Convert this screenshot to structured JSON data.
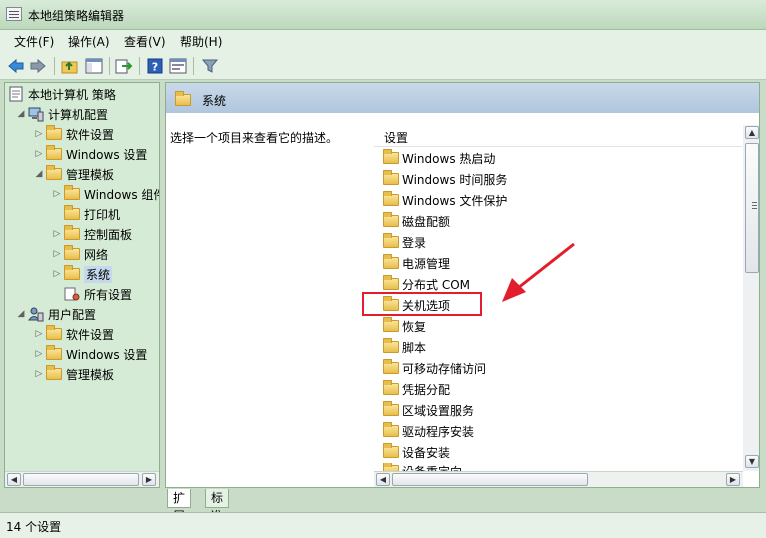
{
  "window": {
    "title": "本地组策略编辑器"
  },
  "menu": [
    "文件(F)",
    "操作(A)",
    "查看(V)",
    "帮助(H)"
  ],
  "toolbar_icons": [
    "back-icon",
    "forward-icon",
    "up-folder-icon",
    "show-hide-tree-icon",
    "export-list-icon",
    "help-icon",
    "properties-icon",
    "filter-icon"
  ],
  "tree": {
    "root": "本地计算机 策略",
    "computer_config": "计算机配置",
    "software_settings_1": "软件设置",
    "windows_settings_1": "Windows 设置",
    "admin_templates_1": "管理模板",
    "windows_components": "Windows 组件",
    "printers": "打印机",
    "control_panel": "控制面板",
    "network": "网络",
    "system": "系统",
    "all_settings": "所有设置",
    "user_config": "用户配置",
    "software_settings_2": "软件设置",
    "windows_settings_2": "Windows 设置",
    "admin_templates_2": "管理模板"
  },
  "right_pane": {
    "header_title": "系统",
    "description": "选择一个项目来查看它的描述。",
    "column_header": "设置",
    "items": [
      "Windows 热启动",
      "Windows 时间服务",
      "Windows 文件保护",
      "磁盘配额",
      "登录",
      "电源管理",
      "分布式 COM",
      "关机选项",
      "恢复",
      "脚本",
      "可移动存储访问",
      "凭据分配",
      "区域设置服务",
      "驱动程序安装",
      "设备安装",
      "设备重定向"
    ]
  },
  "tabs": [
    "扩展",
    "标准"
  ],
  "status": "14 个设置",
  "annotation": {
    "highlighted_item": "关机选项",
    "color": "#e21e2c"
  }
}
